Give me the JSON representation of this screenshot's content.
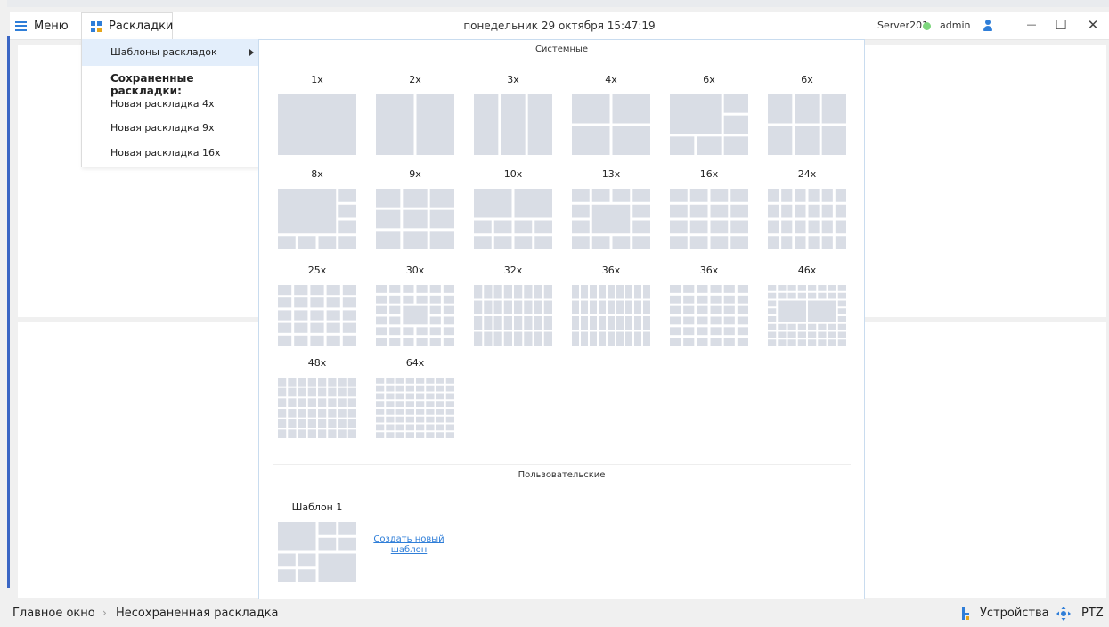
{
  "titlebar": {
    "menu_label": "Меню",
    "layouts_label": "Раскладки",
    "datetime": "понедельник 29 октября 15:47:19",
    "server": "Server201",
    "user": "admin",
    "status_color": "#7dd67d",
    "min_symbol": "—",
    "max_symbol": "☐",
    "close_symbol": "✕"
  },
  "dropdown": {
    "templates_item": "Шаблоны раскладок",
    "saved_header": "Сохраненные раскладки:",
    "saved": [
      "Новая раскладка 4x",
      "Новая раскладка 9x",
      "Новая раскладка 16x"
    ]
  },
  "panel": {
    "system_title": "Системные",
    "system_templates": [
      "1x",
      "2x",
      "3x",
      "4x",
      "6x",
      "6x",
      "8x",
      "9x",
      "10x",
      "13x",
      "16x",
      "24x",
      "25x",
      "30x",
      "32x",
      "36x",
      "36x",
      "46x",
      "48x",
      "64x"
    ],
    "user_title": "Пользовательские",
    "user_templates": [
      "Шаблон 1"
    ],
    "create_link": "Создать новый шаблон"
  },
  "statusbar": {
    "breadcrumb": [
      "Главное окно",
      "Несохраненная раскладка"
    ],
    "separator": "›",
    "devices": "Устройства",
    "ptz": "PTZ"
  },
  "colors": {
    "accent": "#2f7ed8",
    "tile": "#d9dde5",
    "panel_border": "#c9dcef",
    "highlight": "#e3eefb"
  }
}
